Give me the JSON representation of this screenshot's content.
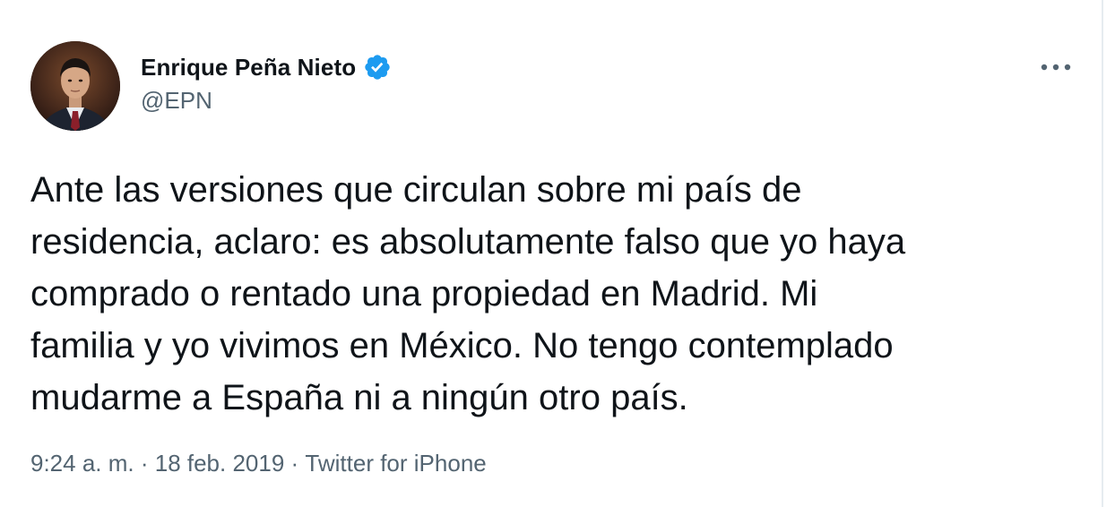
{
  "author": {
    "display_name": "Enrique Peña Nieto",
    "handle": "@EPN",
    "verified": true
  },
  "tweet": {
    "text": "Ante las versiones que circulan sobre mi país de\nresidencia, aclaro: es absolutamente falso que yo haya\ncomprado o rentado una propiedad en Madrid. Mi\nfamilia y yo vivimos en México. No tengo contemplado\nmudarme a España ni a ningún otro país.",
    "time": "9:24 a. m.",
    "date": "18 feb. 2019",
    "source": "Twitter for iPhone",
    "separator": " · "
  },
  "icons": {
    "verified": "verified-badge-icon",
    "more": "more-options-icon"
  },
  "colors": {
    "verified_blue": "#1d9bf0",
    "secondary_text": "#536471",
    "primary_text": "#0f1419"
  }
}
